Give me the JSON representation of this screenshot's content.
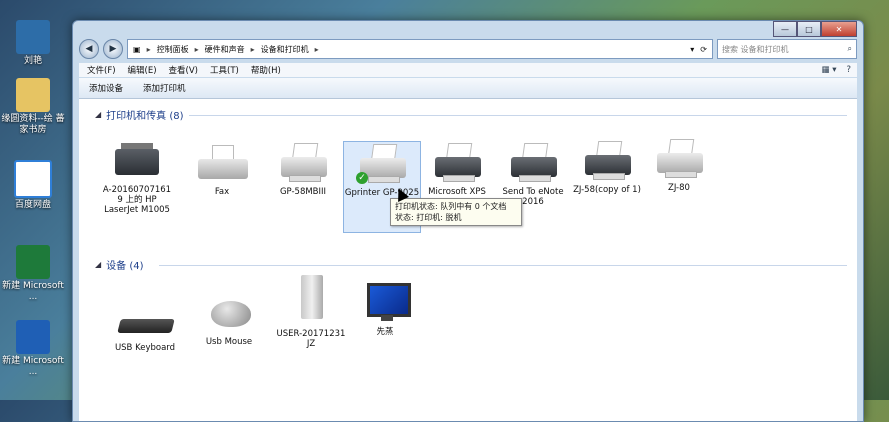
{
  "desktop": {
    "icons": [
      {
        "label": "刘艳"
      },
      {
        "label": "缘圆资料--绘 蕃家书房"
      },
      {
        "label": "百度网盘"
      },
      {
        "label": "新建 Microsoft ..."
      },
      {
        "label": "新建 Microsoft ..."
      }
    ]
  },
  "address": {
    "crumbs": [
      "控制面板",
      "硬件和声音",
      "设备和打印机"
    ],
    "search_placeholder": "搜索 设备和打印机"
  },
  "menu": {
    "items": [
      "文件(F)",
      "编辑(E)",
      "查看(V)",
      "工具(T)",
      "帮助(H)"
    ]
  },
  "toolbar": {
    "add_device": "添加设备",
    "add_printer": "添加打印机"
  },
  "printers_group": {
    "title": "打印机和传真 (8)",
    "items": [
      {
        "label": "A-20160707161 9 上的 HP LaserJet M1005"
      },
      {
        "label": "Fax"
      },
      {
        "label": "GP-58MBIII"
      },
      {
        "label": "Gprinter GP-9025"
      },
      {
        "label": "Microsoft XPS"
      },
      {
        "label": "Send To eNote 2016"
      },
      {
        "label": "ZJ-58(copy of 1)"
      },
      {
        "label": "ZJ-80"
      }
    ]
  },
  "devices_group": {
    "title": "设备 (4)",
    "items": [
      {
        "label": "USB Keyboard"
      },
      {
        "label": "Usb Mouse"
      },
      {
        "label": "USER-20171231 JZ"
      },
      {
        "label": "先蒸"
      }
    ]
  },
  "tooltip": {
    "line1": "打印机状态: 队列中有 0 个文档",
    "line2": "状态: 打印机: 脱机"
  },
  "window": {
    "minimize": "—",
    "maximize": "□",
    "close": "✕"
  }
}
